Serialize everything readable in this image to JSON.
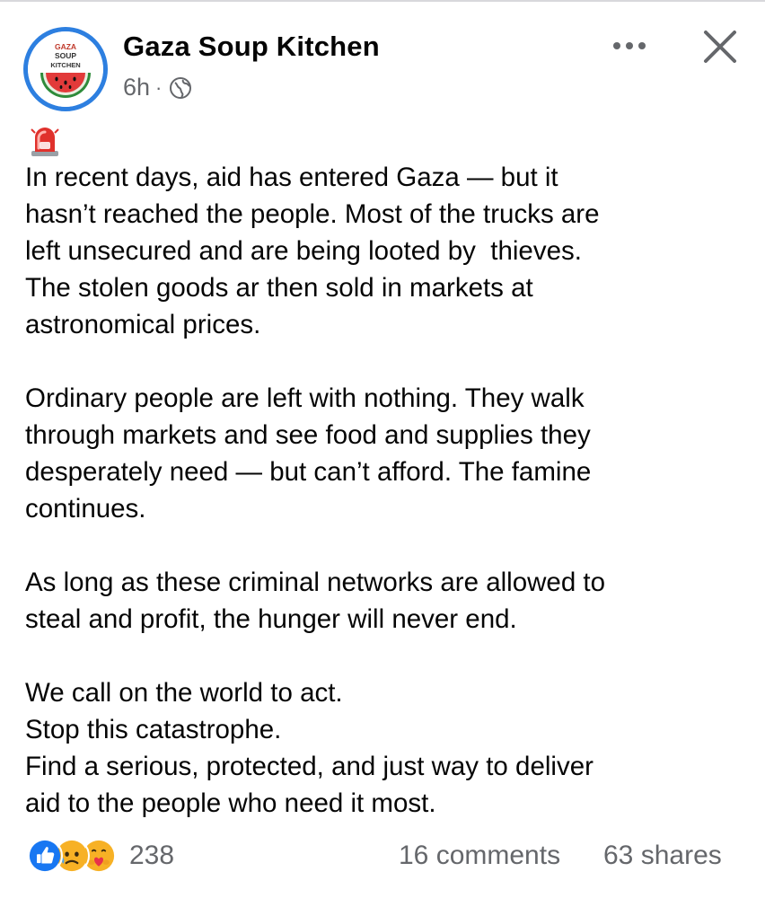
{
  "post": {
    "page_name": "Gaza Soup Kitchen",
    "timestamp": "6h",
    "separator": "·",
    "audience_icon": "globe-icon",
    "avatar": {
      "text_lines": [
        "GAZA",
        "SOUP",
        "KITCHEN"
      ],
      "ring_color": "#2d7fe0"
    },
    "leading_emoji": "rotating-light-emoji",
    "paragraphs": [
      [
        "In recent days, aid has entered Gaza — but it",
        "hasn’t reached the people. Most of the trucks are",
        "left unsecured and are being looted by  thieves.",
        "The stolen goods ar then sold in markets at",
        "astronomical prices."
      ],
      [
        "Ordinary people are left with nothing. They walk",
        "through markets and see food and supplies they",
        "desperately need — but can’t afford. The famine",
        "continues."
      ],
      [
        "As long as these criminal networks are allowed to",
        "steal and profit, the hunger will never end."
      ],
      [
        "We call on the world to act.",
        "Stop this catastrophe.",
        "Find a serious, protected, and just way to deliver",
        "aid to the people who need it most."
      ]
    ]
  },
  "footer": {
    "reaction_icons": [
      "like-icon",
      "sad-icon",
      "care-icon"
    ],
    "reaction_count": "238",
    "comments": "16 comments",
    "shares": "63 shares"
  },
  "colors": {
    "text": "#050505",
    "secondary_text": "#65676b",
    "like_blue": "#1877f2",
    "reaction_yellow": "#f7b125"
  }
}
